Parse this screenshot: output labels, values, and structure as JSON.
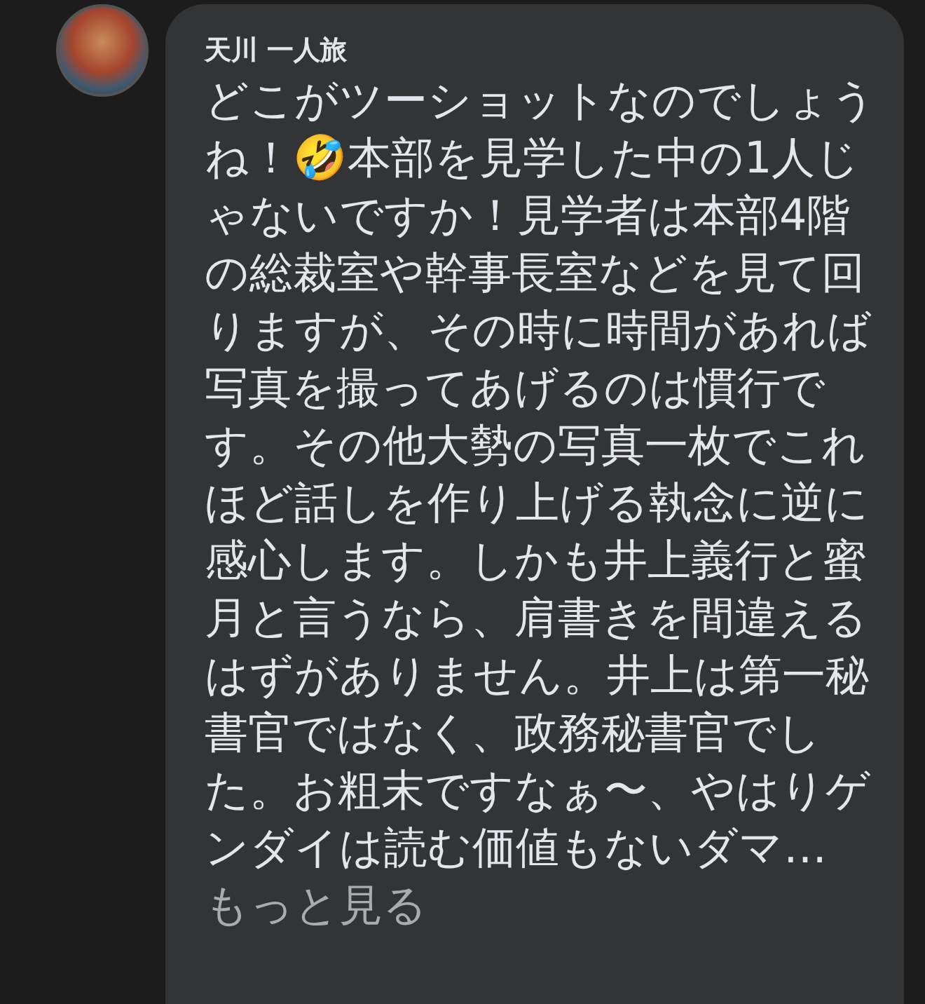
{
  "comment": {
    "author": "天川 一人旅",
    "text": "どこがツーショットなのでしょうね！🤣本部を見学した中の1人じゃないですか！見学者は本部4階の総裁室や幹事長室などを見て回りますが、その時に時間があれば写真を撮ってあげるのは慣行です。その他大勢の写真一枚でこれほど話しを作り上げる執念に逆に感心します。しかも井上義行と蜜月と言うなら、肩書きを間違えるはずがありません。井上は第一秘書官ではなく、政務秘書官でした。お粗末ですなぁ〜、やはりゲンダイは読む価値もないダマ…",
    "see_more": "もっと見る"
  }
}
